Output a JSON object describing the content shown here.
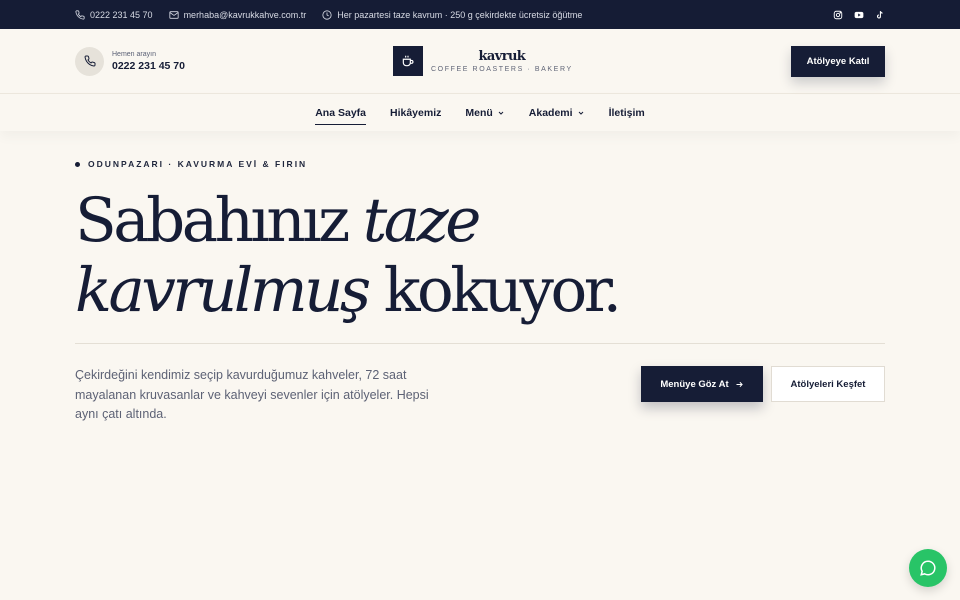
{
  "topbar": {
    "phone": "0222 231 45 70",
    "email": "merhaba@kavrukkahve.com.tr",
    "notice": "Her pazartesi taze kavrum · 250 g çekirdekte ücretsiz öğütme",
    "socials": [
      "instagram-icon",
      "youtube-icon",
      "tiktok-icon"
    ]
  },
  "header": {
    "call_label": "Hemen arayın",
    "call_number": "0222 231 45 70",
    "brand_name": "kavruk",
    "brand_tagline": "COFFEE ROASTERS · BAKERY",
    "cta_label": "Atölyeye Katıl"
  },
  "nav": {
    "items": [
      {
        "label": "Ana Sayfa",
        "active": true
      },
      {
        "label": "Hikâyemiz"
      },
      {
        "label": "Menü",
        "dropdown": true
      },
      {
        "label": "Akademi",
        "dropdown": true
      },
      {
        "label": "İletişim"
      }
    ]
  },
  "hero": {
    "eyebrow": "ODUNPAZARI · KAVURMA EVİ & FIRIN",
    "headline": {
      "line1_plain": "Sabahınız ",
      "line1_italic": "taze",
      "line2_italic": "kavrulmuş",
      "line2_plain": " kokuyor."
    },
    "lede": "Çekirdeğini kendimiz seçip kavurduğumuz kahveler, 72 saat mayalanan kruvasanlar ve kahveyi sevenler için atölyeler. Hepsi aynı çatı altında.",
    "primary_cta": "Menüye Göz At",
    "secondary_cta": "Atölyeleri Keşfet"
  },
  "colors": {
    "navy": "#161d36",
    "cream": "#faf7f1",
    "whatsapp": "#28c467"
  }
}
